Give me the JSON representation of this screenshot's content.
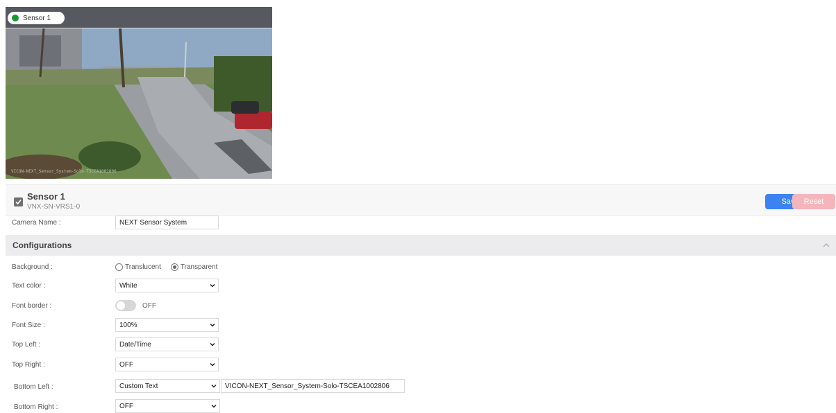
{
  "preview": {
    "sensor_label": "Sensor 1",
    "status_color": "#159b34",
    "overlay_text": "VICON-NEXT_Sensor_System-Solo-TSCEA1002806"
  },
  "sensor": {
    "name": "Sensor 1",
    "model": "VNX-SN-VRS1-0",
    "save_label": "Save",
    "reset_label": "Reset",
    "accent": "#3c82f0"
  },
  "camera_name": {
    "label": "Camera Name :",
    "value": "NEXT Sensor System"
  },
  "configurations": {
    "title": "Configurations",
    "background": {
      "label": "Background :",
      "options": [
        "Translucent",
        "Transparent"
      ],
      "selected": "Transparent"
    },
    "text_color": {
      "label": "Text color :",
      "value": "White"
    },
    "font_border": {
      "label": "Font border :",
      "state": "OFF"
    },
    "font_size": {
      "label": "Font Size :",
      "value": "100%"
    },
    "top_left": {
      "label": "Top Left :",
      "value": "Date/Time"
    },
    "top_right": {
      "label": "Top Right :",
      "value": "OFF"
    },
    "bottom_left": {
      "label": "Bottom Left :",
      "value": "Custom Text",
      "custom_text": "VICON-NEXT_Sensor_System-Solo-TSCEA1002806"
    },
    "bottom_right": {
      "label": "Bottom Right :",
      "value": "OFF"
    }
  }
}
